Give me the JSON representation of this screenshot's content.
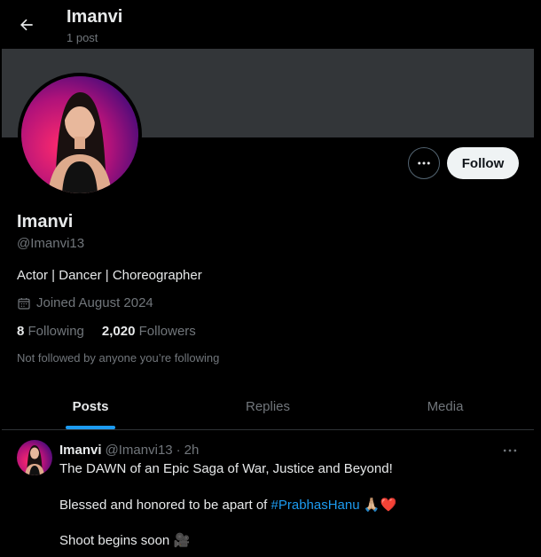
{
  "header": {
    "title": "Imanvi",
    "subtitle": "1 post"
  },
  "profile": {
    "name": "Imanvi",
    "handle": "@Imanvi13",
    "bio": "Actor | Dancer | Choreographer",
    "joined": "Joined August 2024",
    "following_count": "8",
    "following_label": "Following",
    "followers_count": "2,020",
    "followers_label": "Followers",
    "not_followed": "Not followed by anyone you’re following",
    "follow_label": "Follow"
  },
  "tabs": [
    {
      "label": "Posts",
      "active": true
    },
    {
      "label": "Replies",
      "active": false
    },
    {
      "label": "Media",
      "active": false
    }
  ],
  "post": {
    "name": "Imanvi",
    "handle": "@Imanvi13",
    "separator": "·",
    "time": "2h",
    "line1": "The DAWN of an Epic Saga of War, Justice and Beyond!",
    "line2_text": "Blessed and honored to be apart of ",
    "hashtag": "#PrabhasHanu",
    "line2_emoji": "🙏🏼❤️",
    "line3_text": "Shoot begins soon ",
    "line3_emoji": "🎥"
  },
  "colors": {
    "background": "#000000",
    "banner": "#333639",
    "accent": "#1d9bf0",
    "secondary_text": "#71767b",
    "primary_text": "#e7e9ea"
  },
  "icons": [
    "back-arrow-icon",
    "more-icon",
    "calendar-icon"
  ]
}
